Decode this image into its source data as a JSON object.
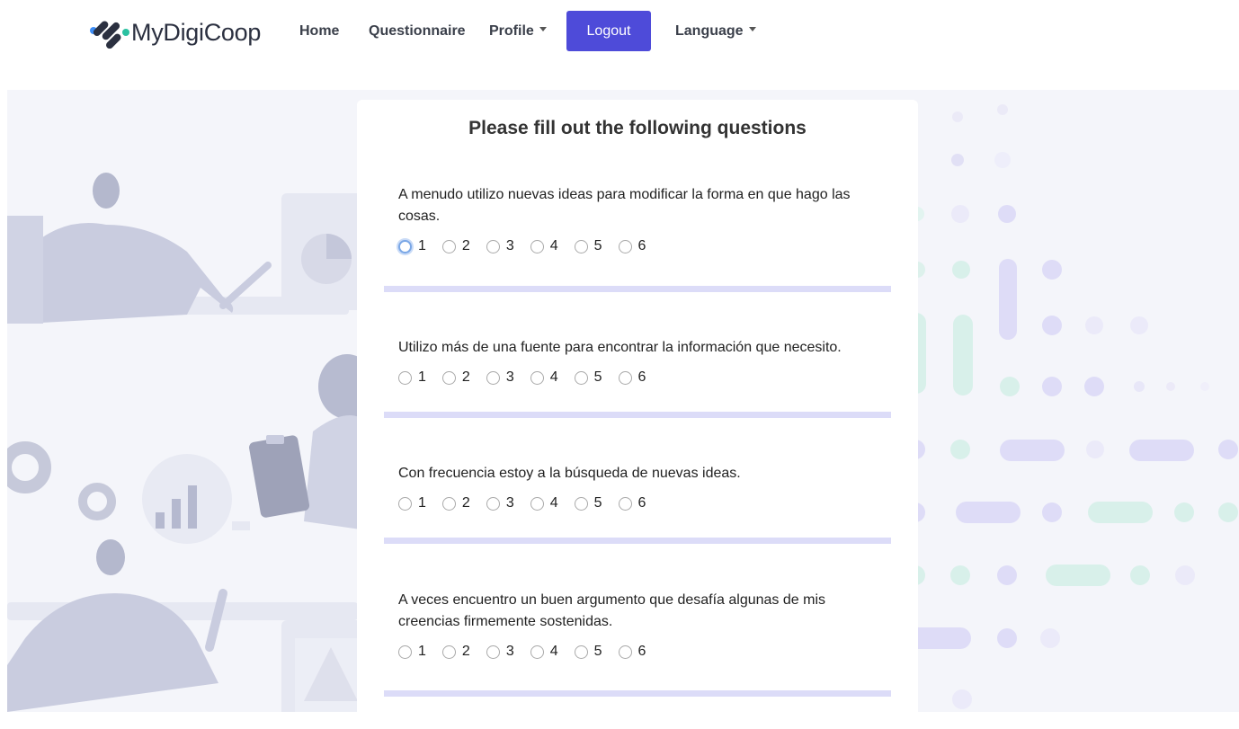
{
  "navbar": {
    "brand_name": "MyDigiCoop",
    "home_label": "Home",
    "questionnaire_label": "Questionnaire",
    "profile_label": "Profile",
    "logout_label": "Logout",
    "language_label": "Language"
  },
  "colors": {
    "accent": "#4e4bd9",
    "divider": "#dcdcf8",
    "page_bg": "#f4f5fa"
  },
  "card": {
    "title": "Please fill out the following questions"
  },
  "questions": [
    {
      "text": "A menudo utilizo nuevas ideas para modificar la forma en que hago las cosas.",
      "options": [
        "1",
        "2",
        "3",
        "4",
        "5",
        "6"
      ]
    },
    {
      "text": "Utilizo más de una fuente para encontrar la información que necesito.",
      "options": [
        "1",
        "2",
        "3",
        "4",
        "5",
        "6"
      ]
    },
    {
      "text": "Con frecuencia estoy a la búsqueda de nuevas ideas.",
      "options": [
        "1",
        "2",
        "3",
        "4",
        "5",
        "6"
      ]
    },
    {
      "text": "A veces encuentro un buen argumento que desafía algunas de mis creencias firmemente sostenidas.",
      "options": [
        "1",
        "2",
        "3",
        "4",
        "5",
        "6"
      ]
    }
  ]
}
